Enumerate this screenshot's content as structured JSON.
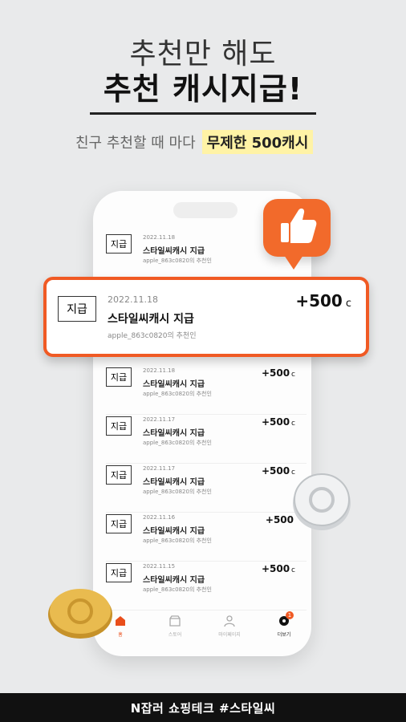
{
  "hero": {
    "line1": "추천만 해도",
    "line2": "추천 캐시지급!",
    "sub_prefix": "친구 추천할 때 마다",
    "sub_highlight": "무제한 500캐시"
  },
  "list": [
    {
      "tag": "지급",
      "date": "2022.11.18",
      "title": "스타일씨캐시 지급",
      "sub": "apple_863c0820의 추천인",
      "amount": "",
      "unit": ""
    },
    {
      "tag": "지급",
      "date": "2022.11.18",
      "title": "스타일씨캐시 지급",
      "sub": "apple_863c0820의 추천인",
      "amount": "+500",
      "unit": "c"
    },
    {
      "tag": "지급",
      "date": "2022.11.17",
      "title": "스타일씨캐시 지급",
      "sub": "apple_863c0820의 추천인",
      "amount": "+500",
      "unit": "c"
    },
    {
      "tag": "지급",
      "date": "2022.11.17",
      "title": "스타일씨캐시 지급",
      "sub": "apple_863c0820의 추천인",
      "amount": "+500",
      "unit": "c"
    },
    {
      "tag": "지급",
      "date": "2022.11.16",
      "title": "스타일씨캐시 지급",
      "sub": "apple_863c0820의 추천인",
      "amount": "+500",
      "unit": ""
    },
    {
      "tag": "지급",
      "date": "2022.11.15",
      "title": "스타일씨캐시 지급",
      "sub": "apple_863c0820의 추천인",
      "amount": "+500",
      "unit": "c"
    }
  ],
  "highlight": {
    "tag": "지급",
    "date": "2022.11.18",
    "title": "스타일씨캐시 지급",
    "sub": "apple_863c0820의 추천인",
    "amount": "+500",
    "unit": "c"
  },
  "tabs": [
    {
      "label": "홈",
      "icon": "home-icon"
    },
    {
      "label": "스토어",
      "icon": "store-icon"
    },
    {
      "label": "마이페이지",
      "icon": "person-icon"
    },
    {
      "label": "더보기",
      "icon": "more-icon",
      "badge": "1"
    }
  ],
  "footer": "N잡러 쇼핑테크 #스타일씨",
  "colors": {
    "accent": "#f05a24",
    "highlight": "#fff3a6",
    "footer_bg": "#111111"
  }
}
